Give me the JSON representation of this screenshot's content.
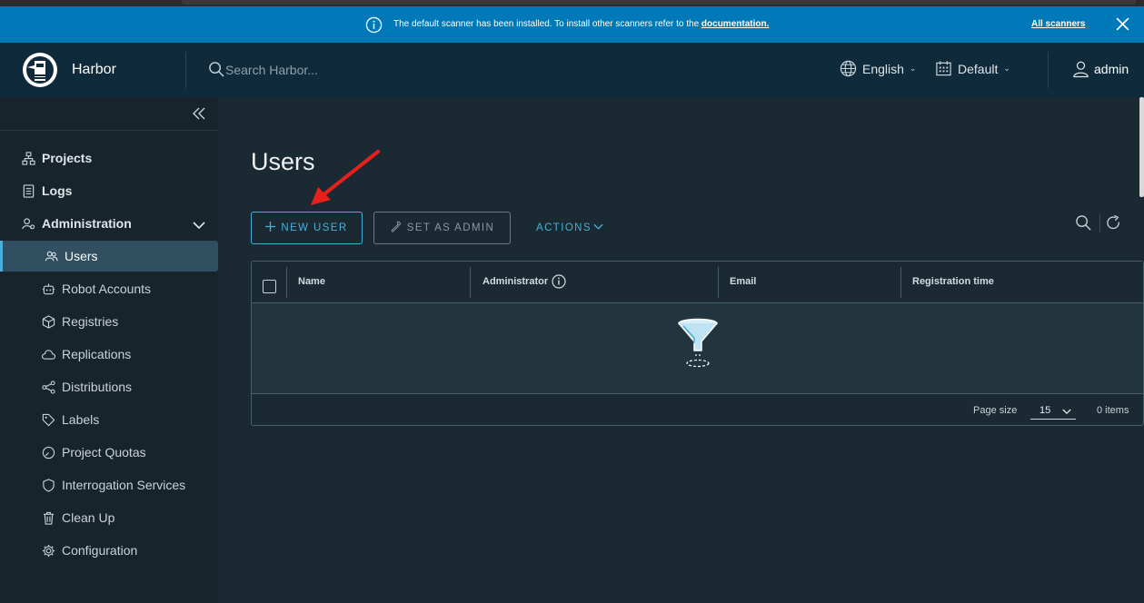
{
  "banner": {
    "message": "The default scanner has been installed. To install other scanners refer to the",
    "link": "documentation.",
    "all_scanners": "All scanners"
  },
  "header": {
    "brand": "Harbor",
    "search_placeholder": "Search Harbor...",
    "language": "English",
    "theme": "Default",
    "user": "admin"
  },
  "sidebar": {
    "projects": "Projects",
    "logs": "Logs",
    "administration": "Administration",
    "items": [
      {
        "label": "Users",
        "icon": "users-icon"
      },
      {
        "label": "Robot Accounts",
        "icon": "robot-icon"
      },
      {
        "label": "Registries",
        "icon": "cube-icon"
      },
      {
        "label": "Replications",
        "icon": "cloud-icon"
      },
      {
        "label": "Distributions",
        "icon": "share-icon"
      },
      {
        "label": "Labels",
        "icon": "tag-icon"
      },
      {
        "label": "Project Quotas",
        "icon": "gauge-icon"
      },
      {
        "label": "Interrogation Services",
        "icon": "shield-icon"
      },
      {
        "label": "Clean Up",
        "icon": "trash-icon"
      },
      {
        "label": "Configuration",
        "icon": "gear-icon"
      }
    ]
  },
  "main": {
    "title": "Users",
    "new_user": "NEW USER",
    "set_as_admin": "SET AS ADMIN",
    "actions": "ACTIONS"
  },
  "grid": {
    "columns": [
      "Name",
      "Administrator",
      "Email",
      "Registration time"
    ],
    "page_size_label": "Page size",
    "page_size": "15",
    "item_count": "0 items"
  },
  "colors": {
    "accent": "#49afd9",
    "banner": "#0079b8",
    "header": "#0f2a3a",
    "annotation": "#e8201c"
  }
}
